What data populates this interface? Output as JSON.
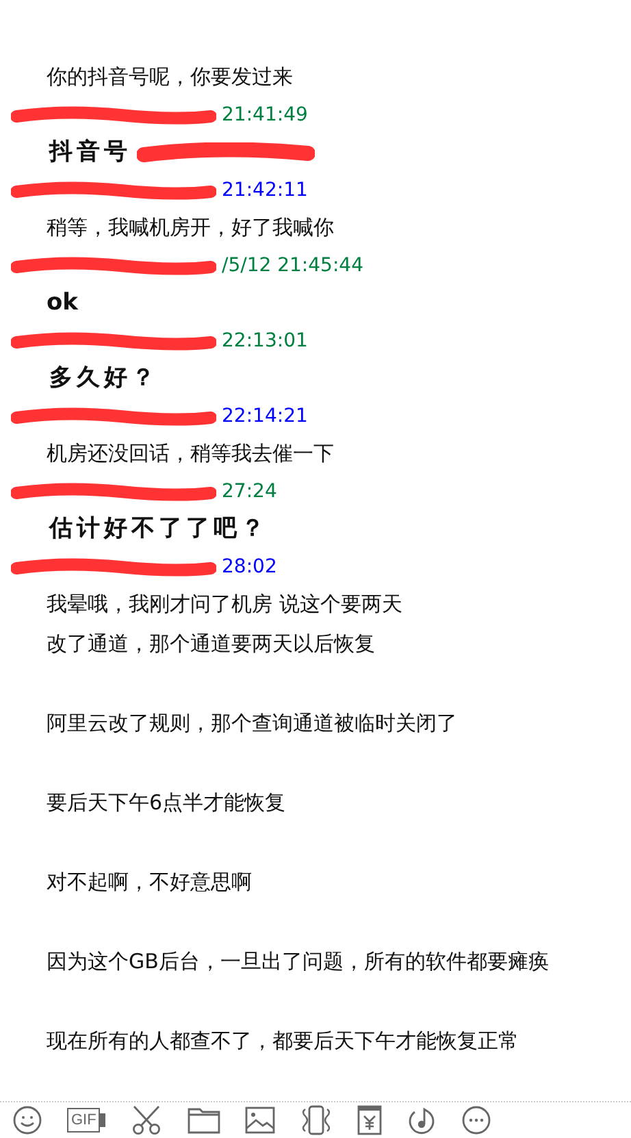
{
  "messages": [
    {
      "kind": "plain",
      "text": "你的抖音号呢，你要发过来"
    },
    {
      "color": "#008040",
      "time": "21:41:49",
      "kind": "bold",
      "text": "抖音号",
      "redacted_tail": true
    },
    {
      "color": "#0000ff",
      "time": "21:42:11",
      "kind": "plain",
      "text": "稍等，我喊机房开，好了我喊你"
    },
    {
      "color": "#008040",
      "time": "/5/12 21:45:44",
      "kind": "boldlatin",
      "text": "ok"
    },
    {
      "color": "#008040",
      "time": "22:13:01",
      "kind": "bold",
      "text": "多久好？"
    },
    {
      "color": "#0000ff",
      "time": "22:14:21",
      "kind": "plain",
      "text": "机房还没回话，稍等我去催一下"
    },
    {
      "color": "#008040",
      "time": "27:24",
      "kind": "bold",
      "text": "估计好不了了吧？"
    },
    {
      "color": "#0000ff",
      "time": "28:02",
      "kind": "paragraphs",
      "paragraphs": [
        [
          "我晕哦，我刚才问了机房  说这个要两天",
          "改了通道，那个通道要两天以后恢复"
        ],
        [
          "阿里云改了规则，那个查询通道被临时关闭了"
        ],
        [
          "要后天下午6点半才能恢复"
        ],
        [
          "对不起啊，不好意思啊"
        ],
        [
          "因为这个GB后台，一旦出了问题，所有的软件都要瘫痪"
        ],
        [
          "现在所有的人都查不了，都要后天下午才能恢复正常"
        ]
      ]
    }
  ],
  "toolbar": [
    {
      "kind": "smiley"
    },
    {
      "kind": "gif",
      "label": "GIF"
    },
    {
      "kind": "scissors"
    },
    {
      "kind": "folder"
    },
    {
      "kind": "image"
    },
    {
      "kind": "vibrate"
    },
    {
      "kind": "yen"
    },
    {
      "kind": "music"
    },
    {
      "kind": "more"
    }
  ]
}
